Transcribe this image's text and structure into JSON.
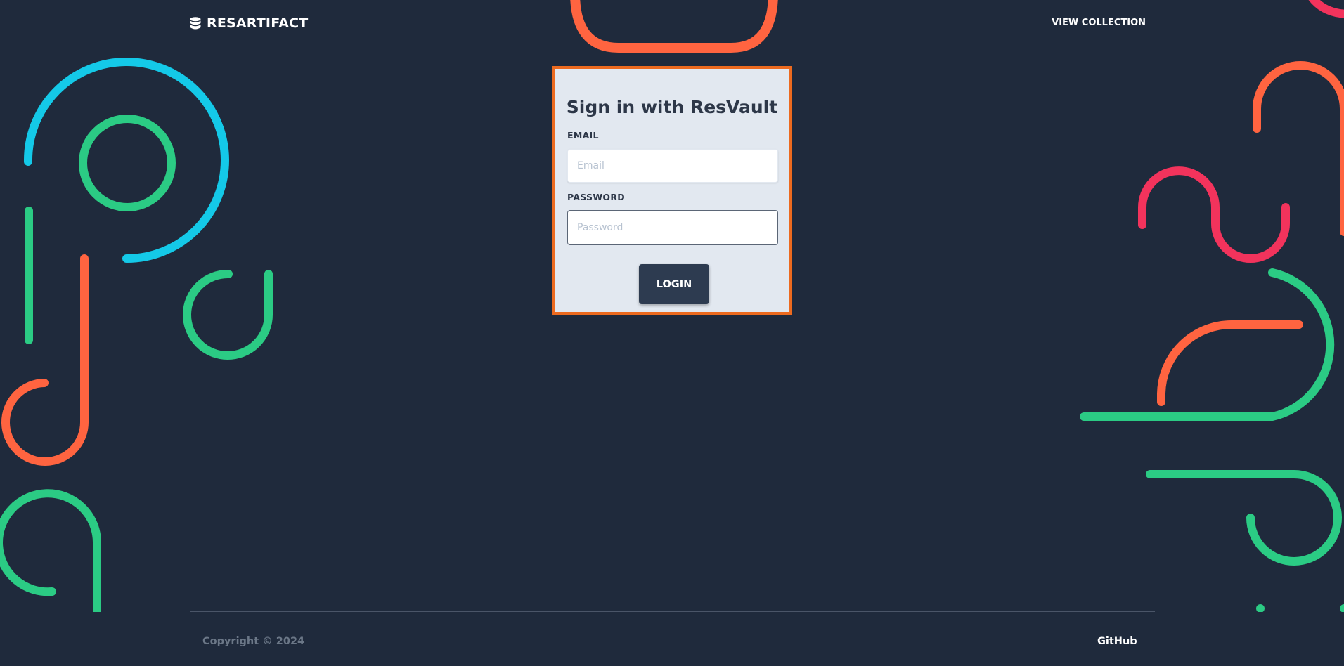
{
  "header": {
    "brand_name": "RESARTIFACT",
    "brand_icon": "database-icon",
    "nav_link": "VIEW COLLECTION"
  },
  "login_card": {
    "title": "Sign in with ResVault",
    "email_label": "EMAIL",
    "email_placeholder": "Email",
    "email_value": "",
    "password_label": "PASSWORD",
    "password_placeholder": "Password",
    "password_value": "",
    "login_button": "LOGIN"
  },
  "footer": {
    "copyright": "Copyright © 2024",
    "github_link": "GitHub"
  },
  "colors": {
    "background": "#1f2a3c",
    "card": "#e2e8f0",
    "card_border": "#ec6a1f",
    "button": "#2d3b50",
    "deco_orange": "#ff6440",
    "deco_green": "#2bcb84",
    "deco_cyan": "#14c9e8",
    "deco_pink": "#f2335c"
  }
}
